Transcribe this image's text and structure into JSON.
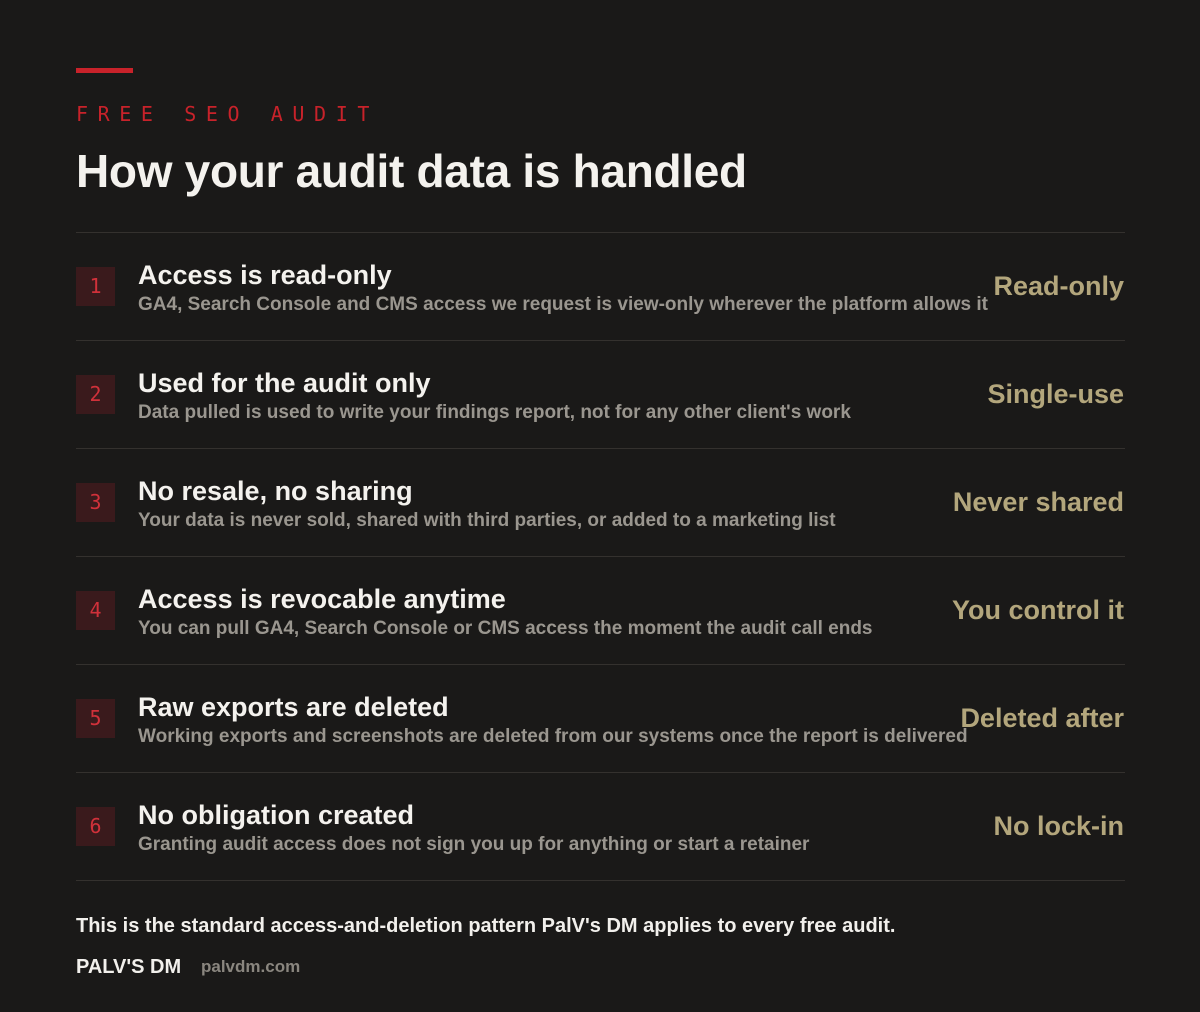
{
  "header": {
    "eyebrow": "FREE SEO AUDIT",
    "title": "How your audit data is handled"
  },
  "items": [
    {
      "number": "1",
      "title": "Access is read-only",
      "description": "GA4, Search Console and CMS access we request is view-only wherever the platform allows it",
      "tag": "Read-only"
    },
    {
      "number": "2",
      "title": "Used for the audit only",
      "description": "Data pulled is used to write your findings report, not for any other client's work",
      "tag": "Single-use"
    },
    {
      "number": "3",
      "title": "No resale, no sharing",
      "description": "Your data is never sold, shared with third parties, or added to a marketing list",
      "tag": "Never shared"
    },
    {
      "number": "4",
      "title": "Access is revocable anytime",
      "description": "You can pull GA4, Search Console or CMS access the moment the audit call ends",
      "tag": "You control it"
    },
    {
      "number": "5",
      "title": "Raw exports are deleted",
      "description": "Working exports and screenshots are deleted from our systems once the report is delivered",
      "tag": "Deleted after"
    },
    {
      "number": "6",
      "title": "No obligation created",
      "description": "Granting audit access does not sign you up for anything or start a retainer",
      "tag": "No lock-in"
    }
  ],
  "footer": {
    "note": "This is the standard access-and-deletion pattern PalV's DM applies to every free audit.",
    "brand": "PALV'S DM",
    "domain": "palvdm.com"
  },
  "colors": {
    "background": "#1a1918",
    "accent": "#c8222a",
    "tag": "#b3a67c",
    "muted": "#9a968f"
  }
}
